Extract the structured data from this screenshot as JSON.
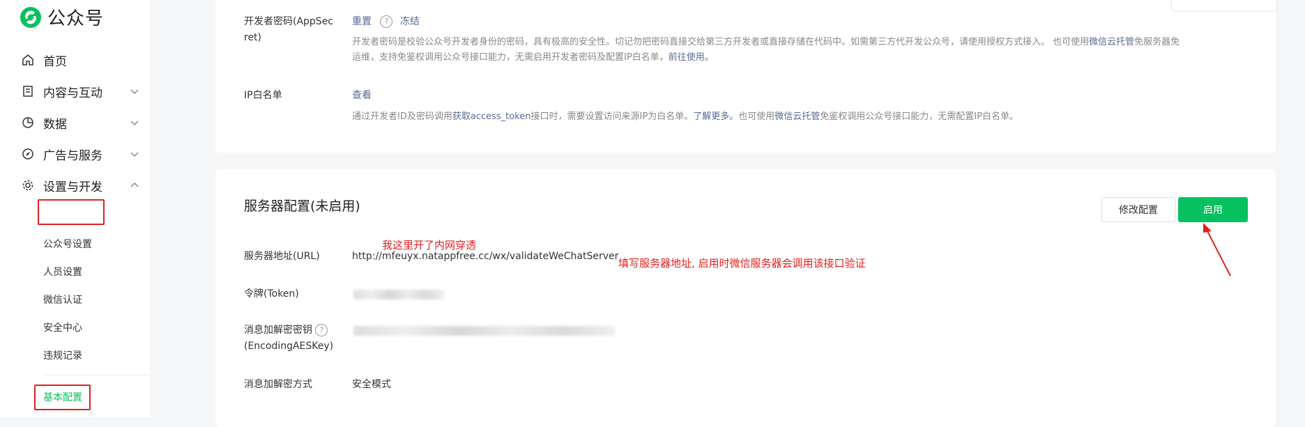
{
  "app": {
    "title": "公众号",
    "brand_color": "#07c160"
  },
  "sidebar": {
    "items": [
      {
        "label": "首页",
        "icon": "home-icon"
      },
      {
        "label": "内容与互动",
        "icon": "document-icon"
      },
      {
        "label": "数据",
        "icon": "pie-chart-icon"
      },
      {
        "label": "广告与服务",
        "icon": "compass-icon"
      },
      {
        "label": "设置与开发",
        "icon": "gear-icon"
      }
    ],
    "sub_items": [
      "公众号设置",
      "人员设置",
      "微信认证",
      "安全中心",
      "违规记录"
    ],
    "active_item": "基本配置"
  },
  "developer": {
    "appsecret_label_1": "开发者密码(AppSec",
    "appsecret_label_2": "ret)",
    "reset_link": "重置",
    "freeze_link": "冻结",
    "appsecret_desc_1a": "开发者密码是校验公众号开发者身份的密码，具有极高的安全性。切记勿把密码直接交给第三方开发者或直接存储在代码中。如需第三方代开发公众号，请使用授权方式接入。 也可使用",
    "appsecret_desc_1_link": "微信云托管",
    "appsecret_desc_1b": "免服务器免",
    "appsecret_desc_2a": "运维，支持免鉴权调用公众号接口能力，无需启用开发者密码及配置IP白名单，",
    "appsecret_desc_2_link": "前往使用。",
    "ip_label": "IP白名单",
    "ip_view_link": "查看",
    "ip_desc_a": "通过开发者ID及密码调用",
    "ip_desc_link1": "获取access_token",
    "ip_desc_b": "接口时，需要设置访问来源IP为白名单。",
    "ip_desc_link2": "了解更多。",
    "ip_desc_c": "也可使用",
    "ip_desc_link3": "微信云托管",
    "ip_desc_d": "免鉴权调用公众号接口能力，无需配置IP白名单。"
  },
  "server": {
    "title": "服务器配置(未启用)",
    "modify_button": "修改配置",
    "enable_button": "启用",
    "url_label": "服务器地址(URL)",
    "url_value": "http://mfeuyx.natappfree.cc/wx/validateWeChatServer",
    "token_label": "令牌(Token)",
    "aes_label_1": "消息加解密密钥",
    "aes_label_2": "(EncodingAESKey)",
    "mode_label": "消息加解密方式",
    "mode_value": "安全模式"
  },
  "annotations": {
    "tunnel_note": "我这里开了内网穿透",
    "url_note": "填写服务器地址, 启用时微信服务器会调用该接口验证"
  }
}
